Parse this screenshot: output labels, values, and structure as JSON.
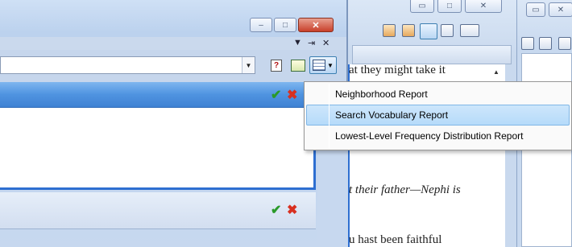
{
  "menu": {
    "items": [
      {
        "label": "Neighborhood Report",
        "highlighted": false
      },
      {
        "label": "Search Vocabulary Report",
        "highlighted": true
      },
      {
        "label": "Lowest-Level Frequency Distribution Report",
        "highlighted": false
      }
    ]
  },
  "document": {
    "line1": "at they might take it",
    "line2": "t their father—Nephi is",
    "line3": "u hast been faithful"
  },
  "glyphs": {
    "minimize": "–",
    "maximize": "□",
    "close": "✕",
    "dropdown": "▼",
    "pin": "⇥",
    "panel_close": "✕",
    "check": "✔",
    "cross": "✖",
    "help": "?",
    "scroll_up": "▲"
  },
  "colors": {
    "selection_blue": "#3f82d3",
    "menu_highlight": "#b6dbfa",
    "ok_green": "#2a9a2a",
    "cancel_red": "#d83020"
  }
}
